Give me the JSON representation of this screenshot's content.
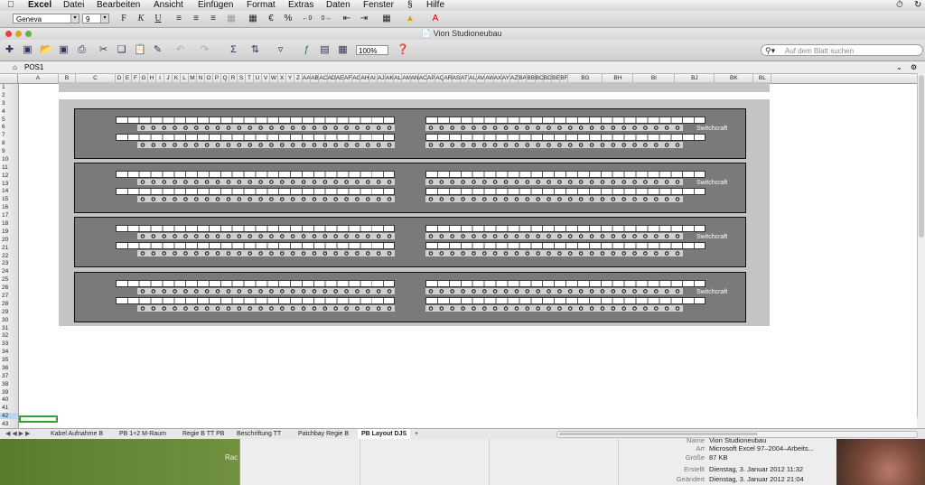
{
  "menubar": {
    "apple": "",
    "app": "Excel",
    "items": [
      "Datei",
      "Bearbeiten",
      "Ansicht",
      "Einfügen",
      "Format",
      "Extras",
      "Daten",
      "Fenster",
      "Hilfe"
    ],
    "script_icon": "script-menu-icon"
  },
  "formatting": {
    "font_name": "Geneva",
    "font_size": "9",
    "bold": "F",
    "italic": "K",
    "underline": "U",
    "percent": "%",
    "euro": "€"
  },
  "window": {
    "title": "Vion Studioneubau",
    "zoom": "100%",
    "search_placeholder": "Auf dem Blatt suchen"
  },
  "sheet": {
    "name": "POS1",
    "columns": [
      "A",
      "B",
      "C",
      "D",
      "E",
      "F",
      "G",
      "H",
      "I",
      "J",
      "K",
      "L",
      "M",
      "N",
      "O",
      "P",
      "Q",
      "R",
      "S",
      "T",
      "U",
      "V",
      "W",
      "X",
      "Y",
      "Z",
      "AA",
      "AB",
      "AC",
      "AD",
      "AE",
      "AF",
      "AG",
      "AH",
      "AI",
      "AJ",
      "AK",
      "AL",
      "AM",
      "AN",
      "AO",
      "AP",
      "AQ",
      "AR",
      "AS",
      "AT",
      "AU",
      "AV",
      "AW",
      "AX",
      "AY",
      "AZ",
      "BA",
      "BB",
      "BC",
      "BD",
      "BE",
      "BF",
      "BG",
      "BH",
      "BI",
      "BJ",
      "BK",
      "BL"
    ],
    "rows": [
      "1",
      "2",
      "3",
      "4",
      "5",
      "6",
      "7",
      "8",
      "9",
      "10",
      "11",
      "12",
      "13",
      "14",
      "15",
      "16",
      "17",
      "18",
      "19",
      "20",
      "21",
      "22",
      "23",
      "24",
      "25",
      "26",
      "27",
      "28",
      "29",
      "30",
      "31",
      "32",
      "33",
      "34",
      "35",
      "36",
      "37",
      "38",
      "39",
      "40",
      "41",
      "42",
      "43"
    ],
    "selected_row": "42"
  },
  "patchbay": {
    "brand": "Switchcraft",
    "units": 4
  },
  "tabs": {
    "items": [
      "Kabel Aufnahme B",
      "PB 1+2 M-Raum",
      "Regie B TT PB",
      "Beschriftung TT",
      "Patchbay Regie B",
      "PB Layout DJS"
    ],
    "active": "PB Layout DJS",
    "add": "+"
  },
  "finder_info": {
    "rows": [
      {
        "key": "Name",
        "value": "Vion Studioneubau"
      },
      {
        "key": "Art",
        "value": "Microsoft Excel 97–2004–Arbeits..."
      },
      {
        "key": "Größe",
        "value": "87 KB"
      },
      {
        "key": "Erstellt",
        "value": "Dienstag, 3. Januar 2012 11:32"
      },
      {
        "key": "Geändert",
        "value": "Dienstag, 3. Januar 2012 21:04"
      }
    ],
    "left_fragment": "Rac"
  }
}
